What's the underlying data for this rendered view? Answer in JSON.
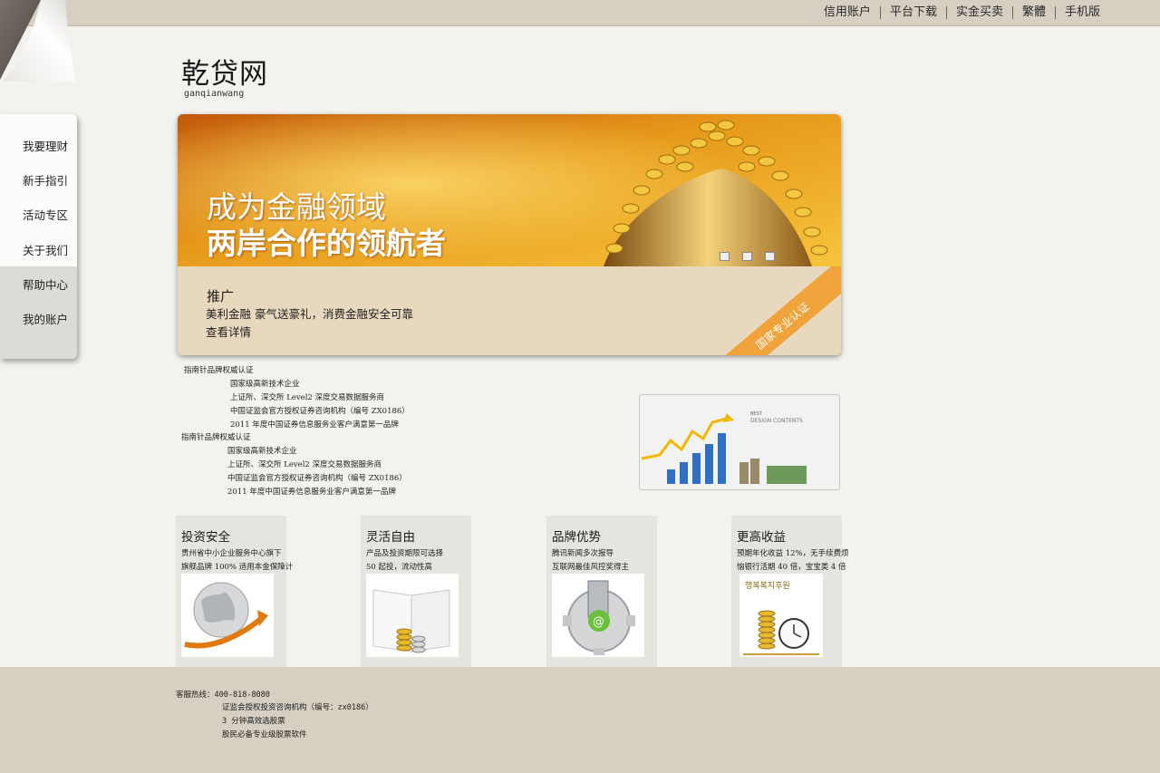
{
  "topnav": [
    "信用账户",
    "平台下载",
    "实金买卖",
    "繁體",
    "手机版"
  ],
  "logo": {
    "title": "乾贷网",
    "subtitle": "ganqianwang"
  },
  "sidemenu": [
    "我要理财",
    "新手指引",
    "活动专区",
    "关于我们",
    "帮助中心",
    "我的账户"
  ],
  "banner": {
    "line1": "成为金融领域",
    "line2": "两岸合作的领航者",
    "promo_title": "推广",
    "promo_text": "美利金融 豪气送豪礼，消费金融安全可靠",
    "promo_link": "查看详情",
    "ribbon": "国家专业认证"
  },
  "cert_blocks": [
    {
      "heading": "指南针品牌权威认证",
      "items": [
        "国家级高新技术企业",
        "上证所、深交所 Level2 深度交易数据服务商",
        "中国证监会官方授权证券咨询机构（编号 ZX0186）",
        "2011 年度中国证券信息服务业客户满意第一品牌"
      ]
    },
    {
      "heading": "指南针品牌权威认证",
      "items": [
        "国家级高新技术企业",
        "上证所、深交所 Level2 深度交易数据服务商",
        "中国证监会官方授权证券咨询机构（编号 ZX0186）",
        "2011 年度中国证券信息服务业客户满意第一品牌"
      ]
    }
  ],
  "chart_image": {
    "caption_top": "BEST",
    "caption_bottom": "DESIGN CONTENTS"
  },
  "features": [
    {
      "title": "投资安全",
      "line1": "贵州省中小企业服务中心旗下",
      "line2": "旗舰品牌 100% 适用本金保障计",
      "icon": "globe-arrow-icon"
    },
    {
      "title": "灵活自由",
      "line1": "产品及投资期限可选择",
      "line2": "50 起投，流动性高",
      "icon": "book-coins-icon"
    },
    {
      "title": "品牌优势",
      "line1": "腾讯新闻多次报导",
      "line2": "互联网最佳风控奖得主",
      "icon": "gear-building-icon"
    },
    {
      "title": "更高收益",
      "line1": "预期年化收益 12%，无手续费烦",
      "line2": "恼银行活期 40 倍，宝宝类 4 倍",
      "icon": "coins-clock-icon",
      "badge": "행복복지후원"
    }
  ],
  "footer": {
    "hotline": "客服热线：400-818-8080",
    "lines": [
      "证监会授权投资咨询机构（编号：zx0186）",
      "3 分钟高效选股票",
      "股民必备专业级股票软件"
    ]
  },
  "colors": {
    "topbar": "#d6cfc2",
    "page": "#f4f2ee",
    "ribbon": "#f0a33a",
    "banner_low": "#e8d8bd"
  }
}
